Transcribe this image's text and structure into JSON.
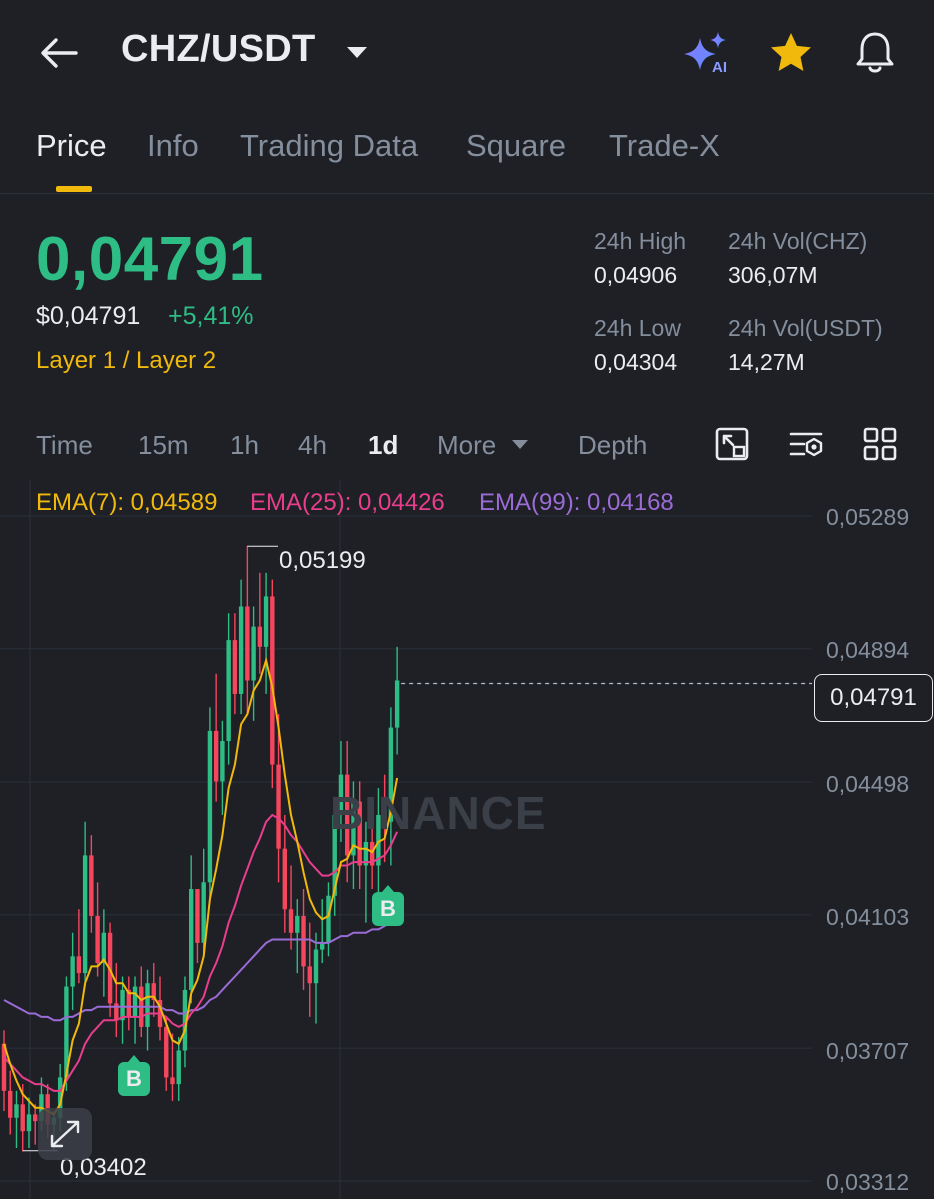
{
  "header": {
    "pair": "CHZ/USDT",
    "icons": [
      "back-arrow-icon",
      "caret-down-icon",
      "ai-sparkle-icon",
      "star-icon",
      "bell-icon"
    ],
    "ai_badge": "AI"
  },
  "tabs": [
    {
      "label": "Price",
      "active": true
    },
    {
      "label": "Info",
      "active": false
    },
    {
      "label": "Trading Data",
      "active": false
    },
    {
      "label": "Square",
      "active": false
    },
    {
      "label": "Trade-X",
      "active": false
    }
  ],
  "price": {
    "last": "0,04791",
    "usd": "$0,04791",
    "change": "+5,41%",
    "tag": "Layer 1 / Layer 2"
  },
  "stats": {
    "high_label": "24h High",
    "high_value": "0,04906",
    "vol_chz_label": "24h Vol(CHZ)",
    "vol_chz_value": "306,07M",
    "low_label": "24h Low",
    "low_value": "0,04304",
    "vol_usdt_label": "24h Vol(USDT)",
    "vol_usdt_value": "14,27M"
  },
  "intervals": {
    "items": [
      "Time",
      "15m",
      "1h",
      "4h",
      "1d"
    ],
    "active": "1d",
    "more": "More",
    "depth": "Depth"
  },
  "ema": {
    "ema7": "EMA(7): 0,04589",
    "ema25": "EMA(25): 0,04426",
    "ema99": "EMA(99): 0,04168"
  },
  "colors": {
    "up": "#2ebd85",
    "down": "#f6465d",
    "ema7": "#f0b90b",
    "ema25": "#e83e8c",
    "ema99": "#9b6bd6",
    "accent": "#f0b90b"
  },
  "chart_data": {
    "type": "candlestick",
    "y_axis_ticks": [
      "0,05289",
      "0,04894",
      "0,04498",
      "0,04103",
      "0,03707",
      "0,03312"
    ],
    "ylim": [
      0.03312,
      0.05289
    ],
    "current_price": "0,04791",
    "high_marker": "0,05199",
    "low_marker": "0,03402",
    "watermark": "BINANCE",
    "buy_marker_label": "B",
    "candles": [
      {
        "o": 0.0372,
        "h": 0.0376,
        "l": 0.0352,
        "c": 0.0358
      },
      {
        "o": 0.0358,
        "h": 0.0364,
        "l": 0.0345,
        "c": 0.035
      },
      {
        "o": 0.035,
        "h": 0.0358,
        "l": 0.0341,
        "c": 0.0354
      },
      {
        "o": 0.0354,
        "h": 0.036,
        "l": 0.034,
        "c": 0.0346
      },
      {
        "o": 0.0346,
        "h": 0.0356,
        "l": 0.0341,
        "c": 0.0351
      },
      {
        "o": 0.0351,
        "h": 0.0354,
        "l": 0.0342,
        "c": 0.0349
      },
      {
        "o": 0.0349,
        "h": 0.0362,
        "l": 0.0346,
        "c": 0.0357
      },
      {
        "o": 0.0357,
        "h": 0.036,
        "l": 0.0344,
        "c": 0.0348
      },
      {
        "o": 0.0348,
        "h": 0.0352,
        "l": 0.034,
        "c": 0.035
      },
      {
        "o": 0.035,
        "h": 0.0366,
        "l": 0.0346,
        "c": 0.0362
      },
      {
        "o": 0.0362,
        "h": 0.0392,
        "l": 0.0358,
        "c": 0.0389
      },
      {
        "o": 0.0389,
        "h": 0.0405,
        "l": 0.0382,
        "c": 0.0398
      },
      {
        "o": 0.0398,
        "h": 0.0412,
        "l": 0.039,
        "c": 0.0393
      },
      {
        "o": 0.0393,
        "h": 0.0438,
        "l": 0.0389,
        "c": 0.0428
      },
      {
        "o": 0.0428,
        "h": 0.0434,
        "l": 0.0405,
        "c": 0.041
      },
      {
        "o": 0.041,
        "h": 0.042,
        "l": 0.0392,
        "c": 0.0396
      },
      {
        "o": 0.0396,
        "h": 0.0412,
        "l": 0.0386,
        "c": 0.0405
      },
      {
        "o": 0.0405,
        "h": 0.0408,
        "l": 0.038,
        "c": 0.0384
      },
      {
        "o": 0.0384,
        "h": 0.0396,
        "l": 0.0374,
        "c": 0.0379
      },
      {
        "o": 0.0379,
        "h": 0.0392,
        "l": 0.0372,
        "c": 0.0388
      },
      {
        "o": 0.0388,
        "h": 0.0392,
        "l": 0.0376,
        "c": 0.038
      },
      {
        "o": 0.038,
        "h": 0.0392,
        "l": 0.0372,
        "c": 0.0389
      },
      {
        "o": 0.0389,
        "h": 0.0395,
        "l": 0.0374,
        "c": 0.0377
      },
      {
        "o": 0.0377,
        "h": 0.0394,
        "l": 0.037,
        "c": 0.039
      },
      {
        "o": 0.039,
        "h": 0.0396,
        "l": 0.038,
        "c": 0.0385
      },
      {
        "o": 0.0385,
        "h": 0.0392,
        "l": 0.0373,
        "c": 0.0377
      },
      {
        "o": 0.0377,
        "h": 0.038,
        "l": 0.0358,
        "c": 0.0362
      },
      {
        "o": 0.0362,
        "h": 0.0375,
        "l": 0.0355,
        "c": 0.036
      },
      {
        "o": 0.036,
        "h": 0.0374,
        "l": 0.0355,
        "c": 0.037
      },
      {
        "o": 0.037,
        "h": 0.0392,
        "l": 0.0365,
        "c": 0.0388
      },
      {
        "o": 0.0388,
        "h": 0.0428,
        "l": 0.0384,
        "c": 0.0418
      },
      {
        "o": 0.0418,
        "h": 0.0412,
        "l": 0.0396,
        "c": 0.0402
      },
      {
        "o": 0.0402,
        "h": 0.043,
        "l": 0.0398,
        "c": 0.042
      },
      {
        "o": 0.042,
        "h": 0.0472,
        "l": 0.0415,
        "c": 0.0465
      },
      {
        "o": 0.0465,
        "h": 0.0482,
        "l": 0.0444,
        "c": 0.045
      },
      {
        "o": 0.045,
        "h": 0.0468,
        "l": 0.044,
        "c": 0.0462
      },
      {
        "o": 0.0462,
        "h": 0.05,
        "l": 0.0455,
        "c": 0.0492
      },
      {
        "o": 0.0492,
        "h": 0.05,
        "l": 0.047,
        "c": 0.0476
      },
      {
        "o": 0.0476,
        "h": 0.051,
        "l": 0.047,
        "c": 0.0502
      },
      {
        "o": 0.0502,
        "h": 0.052,
        "l": 0.047,
        "c": 0.048
      },
      {
        "o": 0.048,
        "h": 0.0502,
        "l": 0.0468,
        "c": 0.0496
      },
      {
        "o": 0.0496,
        "h": 0.0512,
        "l": 0.0482,
        "c": 0.049
      },
      {
        "o": 0.049,
        "h": 0.0512,
        "l": 0.0476,
        "c": 0.0505
      },
      {
        "o": 0.0505,
        "h": 0.051,
        "l": 0.0448,
        "c": 0.0455
      },
      {
        "o": 0.0455,
        "h": 0.047,
        "l": 0.042,
        "c": 0.043
      },
      {
        "o": 0.043,
        "h": 0.044,
        "l": 0.0405,
        "c": 0.0412
      },
      {
        "o": 0.0412,
        "h": 0.0425,
        "l": 0.04,
        "c": 0.0405
      },
      {
        "o": 0.0405,
        "h": 0.0415,
        "l": 0.0393,
        "c": 0.041
      },
      {
        "o": 0.041,
        "h": 0.0418,
        "l": 0.0388,
        "c": 0.0395
      },
      {
        "o": 0.0395,
        "h": 0.0408,
        "l": 0.038,
        "c": 0.039
      },
      {
        "o": 0.039,
        "h": 0.0405,
        "l": 0.0378,
        "c": 0.04
      },
      {
        "o": 0.04,
        "h": 0.0415,
        "l": 0.0396,
        "c": 0.0402
      },
      {
        "o": 0.0402,
        "h": 0.042,
        "l": 0.0398,
        "c": 0.0416
      },
      {
        "o": 0.0416,
        "h": 0.0445,
        "l": 0.041,
        "c": 0.044
      },
      {
        "o": 0.044,
        "h": 0.0462,
        "l": 0.0432,
        "c": 0.0452
      },
      {
        "o": 0.0452,
        "h": 0.0462,
        "l": 0.042,
        "c": 0.0428
      },
      {
        "o": 0.0428,
        "h": 0.045,
        "l": 0.0418,
        "c": 0.0444
      },
      {
        "o": 0.0444,
        "h": 0.045,
        "l": 0.0418,
        "c": 0.0425
      },
      {
        "o": 0.0425,
        "h": 0.0438,
        "l": 0.0408,
        "c": 0.0432
      },
      {
        "o": 0.0432,
        "h": 0.044,
        "l": 0.0418,
        "c": 0.0425
      },
      {
        "o": 0.0425,
        "h": 0.0448,
        "l": 0.0414,
        "c": 0.044
      },
      {
        "o": 0.044,
        "h": 0.0452,
        "l": 0.0426,
        "c": 0.0438
      },
      {
        "o": 0.0438,
        "h": 0.0472,
        "l": 0.0425,
        "c": 0.0466
      },
      {
        "o": 0.0466,
        "h": 0.049,
        "l": 0.0458,
        "c": 0.048
      }
    ],
    "ema7": [
      0.0372,
      0.0366,
      0.0361,
      0.0357,
      0.0355,
      0.0353,
      0.0353,
      0.0352,
      0.0351,
      0.0354,
      0.0363,
      0.0373,
      0.0378,
      0.039,
      0.0395,
      0.0395,
      0.0397,
      0.0394,
      0.039,
      0.039,
      0.0387,
      0.0387,
      0.0385,
      0.0386,
      0.0386,
      0.0383,
      0.0378,
      0.0373,
      0.0372,
      0.0376,
      0.0387,
      0.0391,
      0.0398,
      0.0415,
      0.0424,
      0.0434,
      0.0448,
      0.0455,
      0.0467,
      0.047,
      0.0477,
      0.048,
      0.0486,
      0.0478,
      0.0466,
      0.0452,
      0.044,
      0.0432,
      0.0423,
      0.0415,
      0.0411,
      0.0409,
      0.041,
      0.0418,
      0.0426,
      0.0427,
      0.0431,
      0.043,
      0.043,
      0.0429,
      0.0432,
      0.0433,
      0.0441,
      0.0451
    ],
    "ema25": [
      0.0368,
      0.0366,
      0.0364,
      0.0362,
      0.0361,
      0.036,
      0.036,
      0.0359,
      0.0358,
      0.0358,
      0.0361,
      0.0364,
      0.0367,
      0.0372,
      0.0375,
      0.0377,
      0.0379,
      0.0379,
      0.0379,
      0.038,
      0.038,
      0.038,
      0.038,
      0.0381,
      0.0381,
      0.0381,
      0.038,
      0.0378,
      0.0377,
      0.0378,
      0.0381,
      0.0383,
      0.0386,
      0.0392,
      0.0396,
      0.0401,
      0.0408,
      0.0413,
      0.0419,
      0.0424,
      0.0429,
      0.0433,
      0.0438,
      0.044,
      0.0439,
      0.0437,
      0.0434,
      0.0432,
      0.0429,
      0.0426,
      0.0424,
      0.0422,
      0.0422,
      0.0423,
      0.0425,
      0.0425,
      0.0426,
      0.0426,
      0.0426,
      0.0426,
      0.0427,
      0.0428,
      0.0431,
      0.0435
    ],
    "ema99": [
      0.0385,
      0.0384,
      0.0383,
      0.0382,
      0.0381,
      0.0381,
      0.038,
      0.038,
      0.0379,
      0.0379,
      0.038,
      0.038,
      0.0381,
      0.0382,
      0.0382,
      0.0383,
      0.0383,
      0.0383,
      0.0383,
      0.0383,
      0.0383,
      0.0383,
      0.0383,
      0.0383,
      0.0383,
      0.0383,
      0.0382,
      0.0382,
      0.0381,
      0.0381,
      0.0382,
      0.0382,
      0.0383,
      0.0385,
      0.0386,
      0.0388,
      0.039,
      0.0392,
      0.0394,
      0.0396,
      0.0398,
      0.04,
      0.0402,
      0.0403,
      0.0403,
      0.0403,
      0.0403,
      0.0403,
      0.0403,
      0.0403,
      0.0402,
      0.0402,
      0.0402,
      0.0403,
      0.0404,
      0.0404,
      0.0405,
      0.0405,
      0.0405,
      0.0406,
      0.0406,
      0.0407,
      0.0408,
      0.041
    ]
  }
}
